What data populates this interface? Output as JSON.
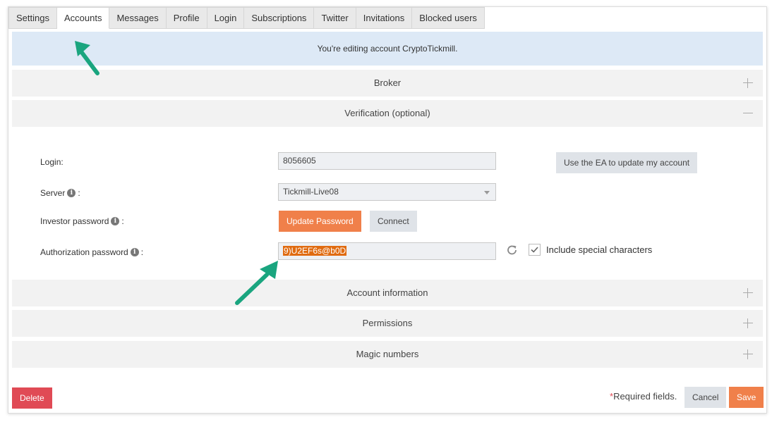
{
  "tabs": [
    {
      "label": "Settings"
    },
    {
      "label": "Accounts"
    },
    {
      "label": "Messages"
    },
    {
      "label": "Profile"
    },
    {
      "label": "Login"
    },
    {
      "label": "Subscriptions"
    },
    {
      "label": "Twitter"
    },
    {
      "label": "Invitations"
    },
    {
      "label": "Blocked users"
    }
  ],
  "active_tab": "Accounts",
  "banner": {
    "text": "You're editing account CryptoTickmill."
  },
  "sections": {
    "broker": "Broker",
    "verification": "Verification (optional)",
    "account_information": "Account information",
    "permissions": "Permissions",
    "magic_numbers": "Magic numbers"
  },
  "verification": {
    "login_label": "Login:",
    "login_value": "8056605",
    "use_ea_button": "Use the EA to update my account",
    "server_label": "Server",
    "server_value": "Tickmill-Live08",
    "investor_password_label": "Investor password",
    "update_password_button": "Update Password",
    "connect_button": "Connect",
    "authorization_password_label": "Authorization password",
    "authorization_password_value": "9)U2EF6s@b0D",
    "include_special_label": "Include special characters",
    "include_special_checked": true,
    "colon": ":"
  },
  "footer": {
    "delete_button": "Delete",
    "required_star": "*",
    "required_text": "Required fields.",
    "cancel_button": "Cancel",
    "save_button": "Save"
  },
  "colors": {
    "banner_bg": "#dde9f6",
    "section_bg": "#f2f2f2",
    "orange_button": "#f0804a",
    "red_button": "#e04a55",
    "annotation_arrow": "#1aa57f"
  },
  "icons": [
    "info-icon",
    "refresh-icon",
    "checkmark-icon",
    "plus-icon",
    "minus-icon",
    "chevron-down-icon",
    "annotation-arrow"
  ]
}
